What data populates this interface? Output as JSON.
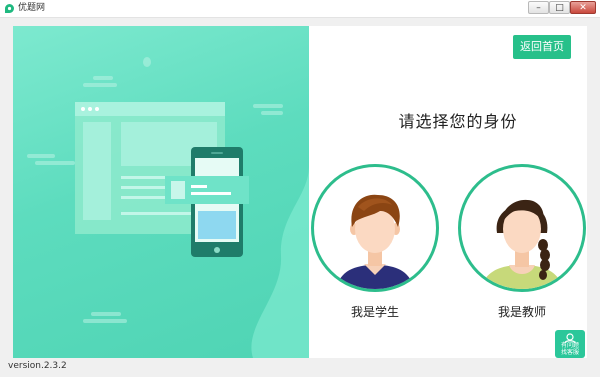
{
  "window": {
    "title": "优题网",
    "minimize_label": "–",
    "maximize_label": "□",
    "close_label": "✕"
  },
  "header": {
    "back_button": "返回首页"
  },
  "main": {
    "prompt": "请选择您的身份",
    "roles": [
      {
        "label": "我是学生",
        "icon": "student-avatar"
      },
      {
        "label": "我是教师",
        "icon": "teacher-avatar"
      }
    ]
  },
  "help": {
    "line1": "有问题",
    "line2": "找客服",
    "icon": "customer-service-icon"
  },
  "footer": {
    "version": "version.2.3.2"
  },
  "colors": {
    "accent": "#27c08a",
    "panel": "#5ddcbe",
    "ring": "#2dbd8c"
  }
}
